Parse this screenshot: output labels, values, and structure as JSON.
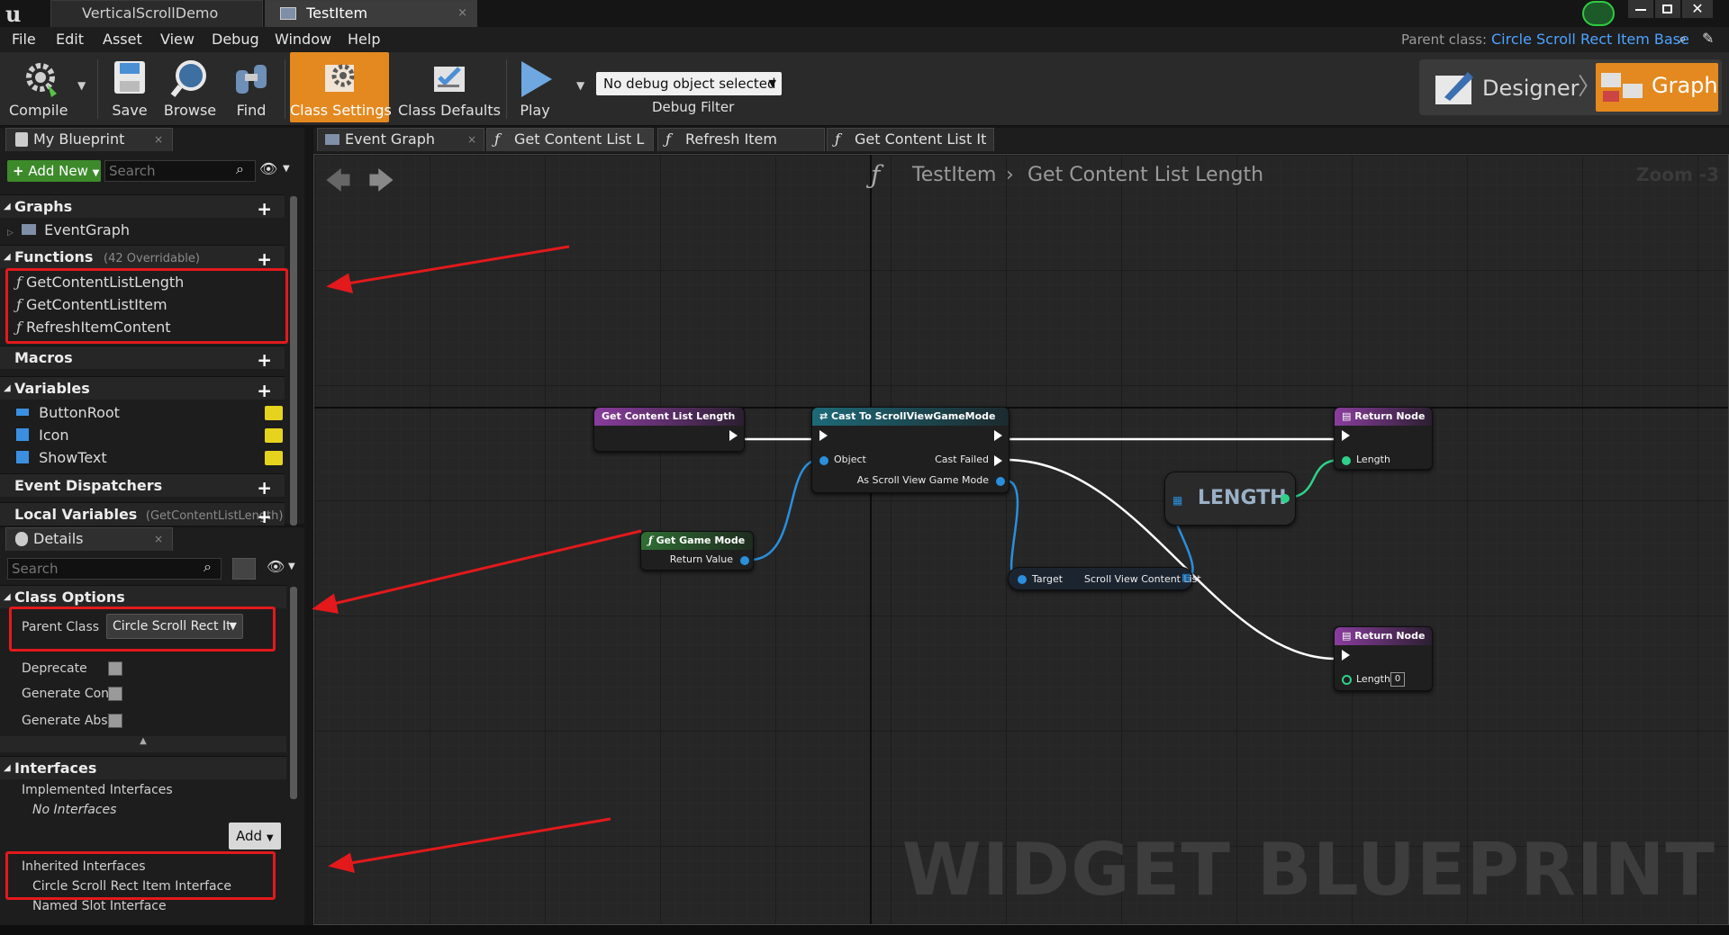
{
  "window": {
    "tabs": [
      {
        "label": "VerticalScrollDemo"
      },
      {
        "label": "TestItem"
      }
    ]
  },
  "menu": {
    "items": [
      "File",
      "Edit",
      "Asset",
      "View",
      "Debug",
      "Window",
      "Help"
    ]
  },
  "parent_class": {
    "label": "Parent class:",
    "value": "Circle Scroll Rect Item Base"
  },
  "toolbar": {
    "compile": "Compile",
    "save": "Save",
    "browse": "Browse",
    "find": "Find",
    "class_settings": "Class Settings",
    "class_defaults": "Class Defaults",
    "play": "Play",
    "debug_object": "No debug object selected",
    "debug_filter": "Debug Filter",
    "designer": "Designer",
    "graph": "Graph"
  },
  "my_blueprint": {
    "tab": "My Blueprint",
    "add_new": "Add New",
    "search_placeholder": "Search",
    "graphs_header": "Graphs",
    "event_graph": "EventGraph",
    "functions_header": "Functions",
    "functions_count": "(42 Overridable)",
    "functions": [
      "GetContentListLength",
      "GetContentListItem",
      "RefreshItemContent"
    ],
    "macros_header": "Macros",
    "variables_header": "Variables",
    "variables": [
      "ButtonRoot",
      "Icon",
      "ShowText"
    ],
    "dispatchers_header": "Event Dispatchers",
    "local_vars_header": "Local Variables",
    "local_vars_scope": "(GetContentListLength)"
  },
  "details": {
    "tab": "Details",
    "search_placeholder": "Search",
    "class_options_header": "Class Options",
    "parent_class_label": "Parent Class",
    "parent_class_value": "Circle Scroll Rect It",
    "deprecate": "Deprecate",
    "generate_con": "Generate Con",
    "generate_abs": "Generate Abs",
    "interfaces_header": "Interfaces",
    "implemented_header": "Implemented Interfaces",
    "no_interfaces": "No Interfaces",
    "add_button": "Add",
    "inherited_header": "Inherited Interfaces",
    "inherited": [
      "Circle Scroll Rect Item Interface",
      "Named Slot Interface"
    ]
  },
  "graph_tabs": [
    "Event Graph",
    "Get Content List L",
    "Refresh Item Conte",
    "Get Content List It"
  ],
  "breadcrumb": {
    "blueprint": "TestItem",
    "function": "Get Content List Length",
    "zoom": "Zoom -3"
  },
  "nodes": {
    "entry": "Get Content List Length",
    "cast": "Cast To ScrollViewGameMode",
    "cast_object": "Object",
    "cast_failed": "Cast Failed",
    "cast_as": "As Scroll View Game Mode",
    "get_game_mode": "Get Game Mode",
    "return_value": "Return Value",
    "length": "LENGTH",
    "target": "Target",
    "scroll_list": "Scroll View Content List",
    "return1": "Return Node",
    "return1_length": "Length",
    "return2": "Return Node",
    "return2_length": "Length",
    "return2_default": "0"
  },
  "watermark": "WIDGET BLUEPRINT",
  "colors": {
    "accent": "#e4891f",
    "highlight": "#e3191c",
    "link": "#4da3ff"
  }
}
